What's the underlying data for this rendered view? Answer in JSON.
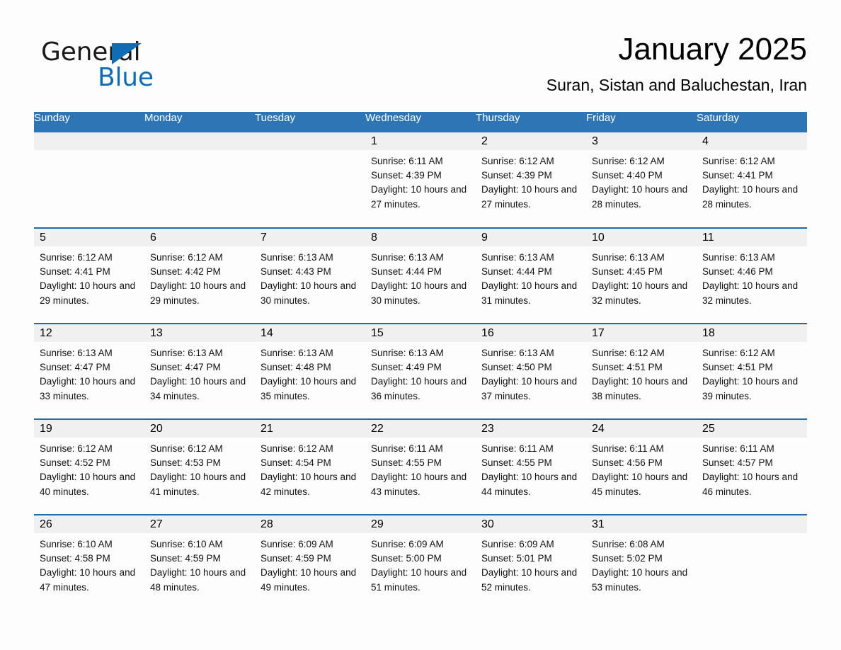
{
  "logo": {
    "word_one": "General",
    "word_two": "Blue",
    "triangle_icon": "triangle-icon",
    "accent_color": "#0f6cb5"
  },
  "header": {
    "month_title": "January 2025",
    "location": "Suran, Sistan and Baluchestan, Iran"
  },
  "theme": {
    "header_blue": "#2e75b6",
    "separator_blue": "#1f6cad",
    "day_strip_gray": "#f0f0f0",
    "page_background": "#fdfdfd"
  },
  "calendar": {
    "weekday_headers": [
      "Sunday",
      "Monday",
      "Tuesday",
      "Wednesday",
      "Thursday",
      "Friday",
      "Saturday"
    ],
    "weeks": [
      [
        {
          "day": "",
          "sunrise": "",
          "sunset": "",
          "daylight": ""
        },
        {
          "day": "",
          "sunrise": "",
          "sunset": "",
          "daylight": ""
        },
        {
          "day": "",
          "sunrise": "",
          "sunset": "",
          "daylight": ""
        },
        {
          "day": "1",
          "sunrise": "Sunrise: 6:11 AM",
          "sunset": "Sunset: 4:39 PM",
          "daylight": "Daylight: 10 hours and 27 minutes."
        },
        {
          "day": "2",
          "sunrise": "Sunrise: 6:12 AM",
          "sunset": "Sunset: 4:39 PM",
          "daylight": "Daylight: 10 hours and 27 minutes."
        },
        {
          "day": "3",
          "sunrise": "Sunrise: 6:12 AM",
          "sunset": "Sunset: 4:40 PM",
          "daylight": "Daylight: 10 hours and 28 minutes."
        },
        {
          "day": "4",
          "sunrise": "Sunrise: 6:12 AM",
          "sunset": "Sunset: 4:41 PM",
          "daylight": "Daylight: 10 hours and 28 minutes."
        }
      ],
      [
        {
          "day": "5",
          "sunrise": "Sunrise: 6:12 AM",
          "sunset": "Sunset: 4:41 PM",
          "daylight": "Daylight: 10 hours and 29 minutes."
        },
        {
          "day": "6",
          "sunrise": "Sunrise: 6:12 AM",
          "sunset": "Sunset: 4:42 PM",
          "daylight": "Daylight: 10 hours and 29 minutes."
        },
        {
          "day": "7",
          "sunrise": "Sunrise: 6:13 AM",
          "sunset": "Sunset: 4:43 PM",
          "daylight": "Daylight: 10 hours and 30 minutes."
        },
        {
          "day": "8",
          "sunrise": "Sunrise: 6:13 AM",
          "sunset": "Sunset: 4:44 PM",
          "daylight": "Daylight: 10 hours and 30 minutes."
        },
        {
          "day": "9",
          "sunrise": "Sunrise: 6:13 AM",
          "sunset": "Sunset: 4:44 PM",
          "daylight": "Daylight: 10 hours and 31 minutes."
        },
        {
          "day": "10",
          "sunrise": "Sunrise: 6:13 AM",
          "sunset": "Sunset: 4:45 PM",
          "daylight": "Daylight: 10 hours and 32 minutes."
        },
        {
          "day": "11",
          "sunrise": "Sunrise: 6:13 AM",
          "sunset": "Sunset: 4:46 PM",
          "daylight": "Daylight: 10 hours and 32 minutes."
        }
      ],
      [
        {
          "day": "12",
          "sunrise": "Sunrise: 6:13 AM",
          "sunset": "Sunset: 4:47 PM",
          "daylight": "Daylight: 10 hours and 33 minutes."
        },
        {
          "day": "13",
          "sunrise": "Sunrise: 6:13 AM",
          "sunset": "Sunset: 4:47 PM",
          "daylight": "Daylight: 10 hours and 34 minutes."
        },
        {
          "day": "14",
          "sunrise": "Sunrise: 6:13 AM",
          "sunset": "Sunset: 4:48 PM",
          "daylight": "Daylight: 10 hours and 35 minutes."
        },
        {
          "day": "15",
          "sunrise": "Sunrise: 6:13 AM",
          "sunset": "Sunset: 4:49 PM",
          "daylight": "Daylight: 10 hours and 36 minutes."
        },
        {
          "day": "16",
          "sunrise": "Sunrise: 6:13 AM",
          "sunset": "Sunset: 4:50 PM",
          "daylight": "Daylight: 10 hours and 37 minutes."
        },
        {
          "day": "17",
          "sunrise": "Sunrise: 6:12 AM",
          "sunset": "Sunset: 4:51 PM",
          "daylight": "Daylight: 10 hours and 38 minutes."
        },
        {
          "day": "18",
          "sunrise": "Sunrise: 6:12 AM",
          "sunset": "Sunset: 4:51 PM",
          "daylight": "Daylight: 10 hours and 39 minutes."
        }
      ],
      [
        {
          "day": "19",
          "sunrise": "Sunrise: 6:12 AM",
          "sunset": "Sunset: 4:52 PM",
          "daylight": "Daylight: 10 hours and 40 minutes."
        },
        {
          "day": "20",
          "sunrise": "Sunrise: 6:12 AM",
          "sunset": "Sunset: 4:53 PM",
          "daylight": "Daylight: 10 hours and 41 minutes."
        },
        {
          "day": "21",
          "sunrise": "Sunrise: 6:12 AM",
          "sunset": "Sunset: 4:54 PM",
          "daylight": "Daylight: 10 hours and 42 minutes."
        },
        {
          "day": "22",
          "sunrise": "Sunrise: 6:11 AM",
          "sunset": "Sunset: 4:55 PM",
          "daylight": "Daylight: 10 hours and 43 minutes."
        },
        {
          "day": "23",
          "sunrise": "Sunrise: 6:11 AM",
          "sunset": "Sunset: 4:55 PM",
          "daylight": "Daylight: 10 hours and 44 minutes."
        },
        {
          "day": "24",
          "sunrise": "Sunrise: 6:11 AM",
          "sunset": "Sunset: 4:56 PM",
          "daylight": "Daylight: 10 hours and 45 minutes."
        },
        {
          "day": "25",
          "sunrise": "Sunrise: 6:11 AM",
          "sunset": "Sunset: 4:57 PM",
          "daylight": "Daylight: 10 hours and 46 minutes."
        }
      ],
      [
        {
          "day": "26",
          "sunrise": "Sunrise: 6:10 AM",
          "sunset": "Sunset: 4:58 PM",
          "daylight": "Daylight: 10 hours and 47 minutes."
        },
        {
          "day": "27",
          "sunrise": "Sunrise: 6:10 AM",
          "sunset": "Sunset: 4:59 PM",
          "daylight": "Daylight: 10 hours and 48 minutes."
        },
        {
          "day": "28",
          "sunrise": "Sunrise: 6:09 AM",
          "sunset": "Sunset: 4:59 PM",
          "daylight": "Daylight: 10 hours and 49 minutes."
        },
        {
          "day": "29",
          "sunrise": "Sunrise: 6:09 AM",
          "sunset": "Sunset: 5:00 PM",
          "daylight": "Daylight: 10 hours and 51 minutes."
        },
        {
          "day": "30",
          "sunrise": "Sunrise: 6:09 AM",
          "sunset": "Sunset: 5:01 PM",
          "daylight": "Daylight: 10 hours and 52 minutes."
        },
        {
          "day": "31",
          "sunrise": "Sunrise: 6:08 AM",
          "sunset": "Sunset: 5:02 PM",
          "daylight": "Daylight: 10 hours and 53 minutes."
        },
        {
          "day": "",
          "sunrise": "",
          "sunset": "",
          "daylight": ""
        }
      ]
    ]
  }
}
